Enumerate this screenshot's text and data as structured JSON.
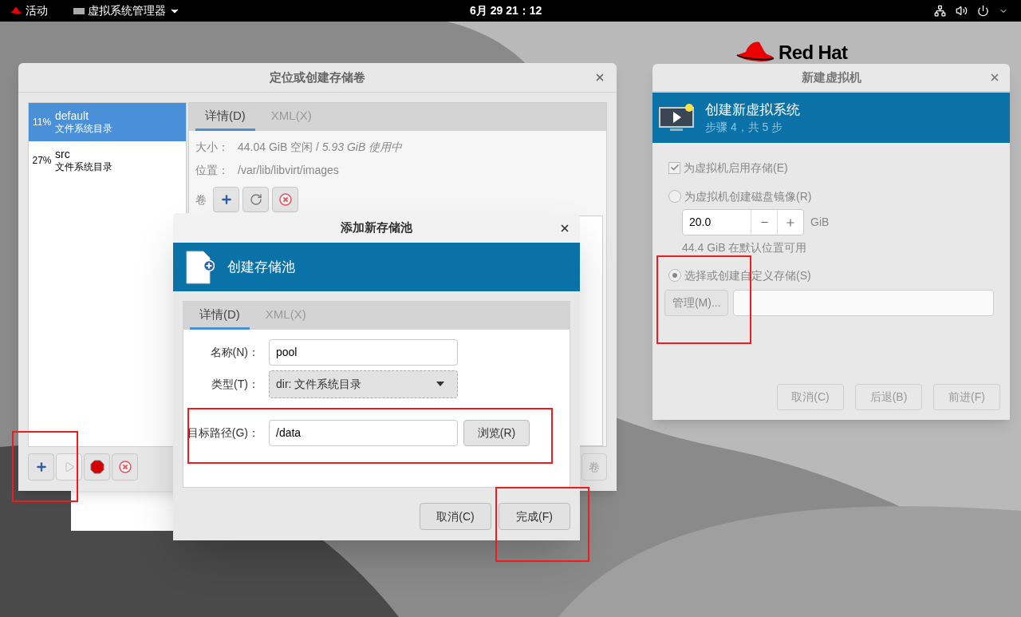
{
  "top_bar": {
    "activities": "活动",
    "app_menu": "虚拟系统管理器",
    "clock": "6月 29  21：12"
  },
  "desktop": {
    "logo_text": "Red Hat"
  },
  "storage_window": {
    "title": "定位或创建存储卷",
    "pools": [
      {
        "usage": "11%",
        "name": "default",
        "type": "文件系统目录",
        "selected": true
      },
      {
        "usage": "27%",
        "name": "src",
        "type": "文件系统目录",
        "selected": false
      }
    ],
    "tabs": [
      {
        "label": "详情(D)",
        "selected": true
      },
      {
        "label": "XML(X)",
        "selected": false
      }
    ],
    "details": [
      {
        "label": "大小：",
        "value": "44.04 GiB 空闲 / *5.93 GiB 使用中*"
      },
      {
        "label": "位置：",
        "value": "/var/lib/libvirt/images"
      }
    ],
    "volumes_label": "卷",
    "volume_actions": [
      {
        "kind": "add",
        "disabled": false
      },
      {
        "kind": "refresh",
        "disabled": false
      },
      {
        "kind": "delete",
        "disabled": false
      }
    ],
    "pool_actions": [
      {
        "kind": "add",
        "disabled": false
      },
      {
        "kind": "start",
        "disabled": true
      },
      {
        "kind": "stop",
        "disabled": false
      },
      {
        "kind": "delete",
        "disabled": false
      }
    ],
    "partial_button": "卷"
  },
  "add_pool_dialog": {
    "title": "添加新存储池",
    "header": "创建存储池",
    "tabs": [
      {
        "label": "详情(D)",
        "selected": true
      },
      {
        "label": "XML(X)",
        "selected": false
      }
    ],
    "name": {
      "label": "名称(N)：",
      "value": "pool"
    },
    "type": {
      "label": "类型(T)：",
      "value": "dir: 文件系统目录"
    },
    "target": {
      "label": "目标路径(G)：",
      "value": "/data",
      "browse": "浏览(R)"
    },
    "buttons": [
      {
        "label": "取消(C)"
      },
      {
        "label": "完成(F)"
      }
    ]
  },
  "new_vm_window": {
    "title": "新建虚拟机",
    "header": "创建新虚拟系统",
    "step": "步骤 4，共 5 步",
    "options": [
      {
        "kind": "checkbox",
        "label": "为虚拟机启用存储(E)",
        "checked": true
      },
      {
        "kind": "radio",
        "label": "为虚拟机创建磁盘镜像(R)",
        "selected": false
      }
    ],
    "disk_size": {
      "value": "20.0",
      "unit": "GiB"
    },
    "available": "44.4 GiB 在默认位置可用",
    "custom_option": {
      "kind": "radio",
      "label": "选择或创建自定义存储(S)",
      "selected": true
    },
    "manage_button": "管理(M)...",
    "buttons": [
      {
        "label": "取消(C)",
        "disabled": true
      },
      {
        "label": "后退(B)",
        "disabled": true
      },
      {
        "label": "前进(F)",
        "disabled": true
      }
    ]
  }
}
